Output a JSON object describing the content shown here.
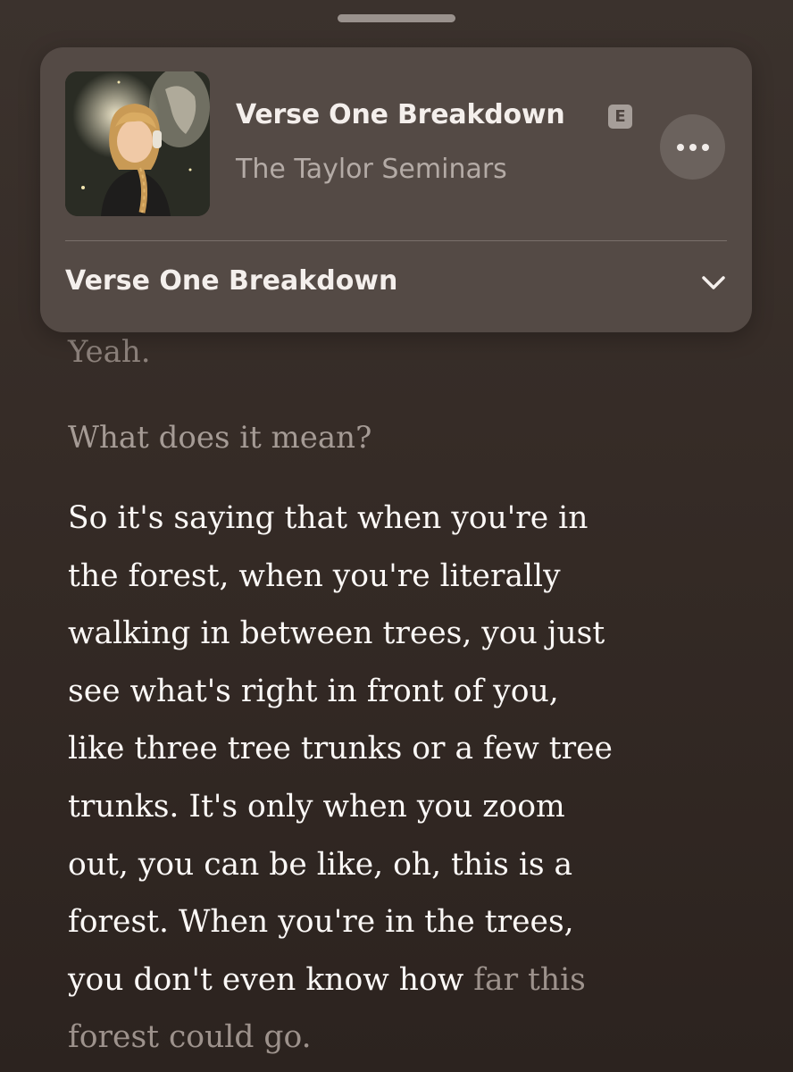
{
  "now_playing": {
    "title": "Verse One Breakdown",
    "explicit_badge": "E",
    "author": "The Taylor Seminars",
    "chapter": "Verse One Breakdown",
    "icons": {
      "more": "ellipsis-icon",
      "chapter_toggle": "chevron-down-icon",
      "artwork": "podcast-artwork"
    }
  },
  "transcript": {
    "previous_line": "Yeah.",
    "question": "What does it mean?",
    "answer_lines": [
      "So it's saying that when you're in",
      "the forest, when you're literally",
      "walking in between trees, you just",
      "see what's right in front of you,",
      "like three tree trunks or a few tree",
      "trunks. It's only when you zoom",
      "out, you can be like, oh, this is a",
      "forest. When you're in the trees,"
    ],
    "answer_line_9_spoken": "you don't even know how ",
    "answer_line_9_upcoming": "far this",
    "answer_line_10_upcoming": "forest could go."
  },
  "colors": {
    "background": "#352b26",
    "card": "#544a45",
    "text_primary": "#fbf8f6",
    "text_upcoming": "#9d928c"
  }
}
